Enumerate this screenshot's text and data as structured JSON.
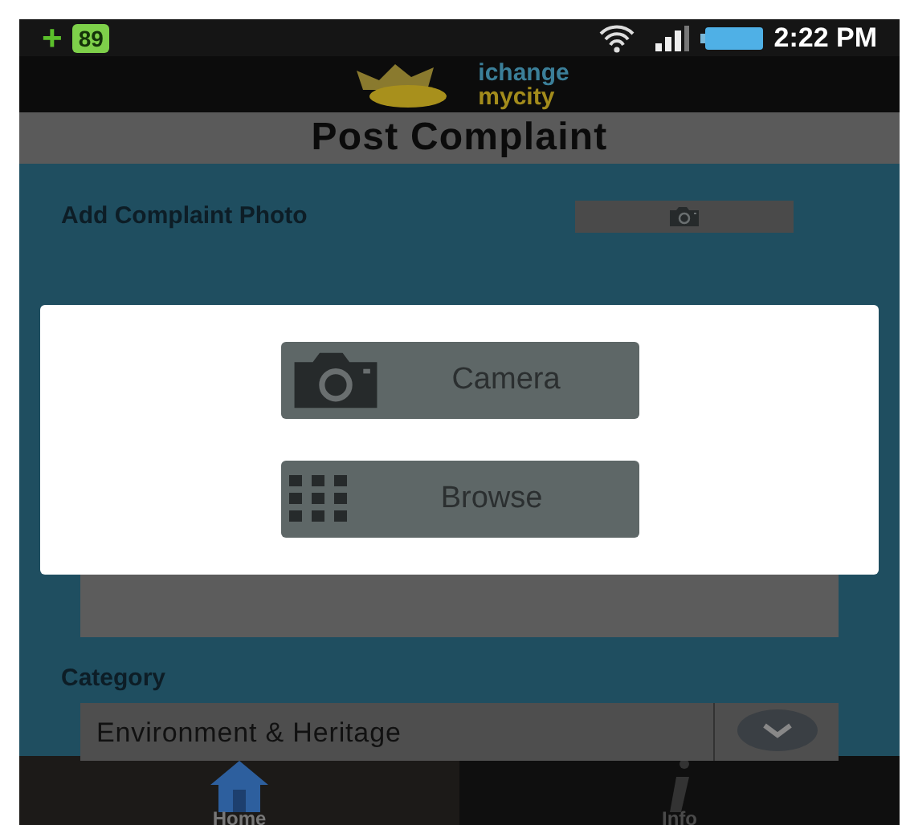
{
  "status_bar": {
    "notification": "+",
    "battery_badge": "89",
    "time": "2:22 PM"
  },
  "logo": {
    "line_1": "ichange",
    "line_2": "mycity"
  },
  "title": "Post Complaint",
  "photo_label": "Add Complaint Photo",
  "dialog": {
    "buttons": [
      {
        "kind": "camera",
        "label": "Camera"
      },
      {
        "kind": "browse",
        "label": "Browse"
      }
    ]
  },
  "category": {
    "label": "Category",
    "value": "Environment & Heritage"
  },
  "nav": [
    {
      "label": "Home",
      "kind": "home",
      "selected": true
    },
    {
      "label": "Info",
      "kind": "info",
      "selected": false
    }
  ]
}
